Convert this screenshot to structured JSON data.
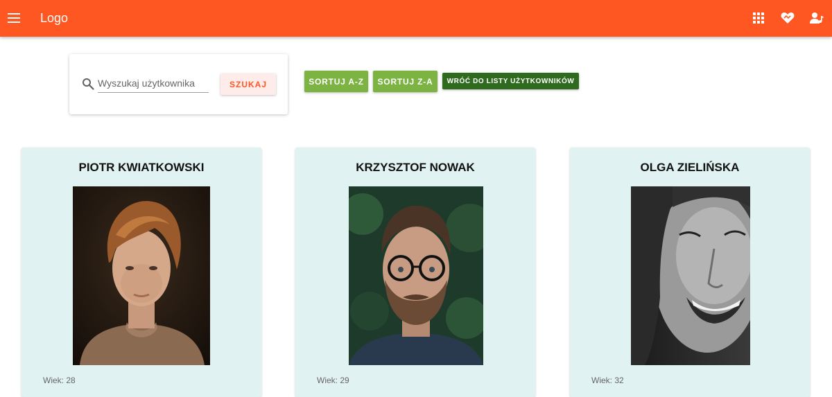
{
  "appbar": {
    "logo": "Logo",
    "menu_icon": "menu-icon",
    "actions": [
      "apps-grid-icon",
      "heart-handshake-icon",
      "person-music-icon"
    ],
    "color": "#ff5722"
  },
  "search": {
    "placeholder": "Wyszukaj użytkownika",
    "value": "",
    "button_label": "SZUKAJ"
  },
  "toolbar": {
    "sort_az": "SORTUJ A-Z",
    "sort_za": "SORTUJ Z-A",
    "back": "WRÓĆ DO LISTY UŻYTKOWNIKÓW"
  },
  "users": [
    {
      "name": "PIOTR KWIATKOWSKI",
      "age": "Wiek: 28"
    },
    {
      "name": "KRZYSZTOF NOWAK",
      "age": "Wiek: 29"
    },
    {
      "name": "OLGA ZIELIŃSKA",
      "age": "Wiek: 32"
    }
  ]
}
